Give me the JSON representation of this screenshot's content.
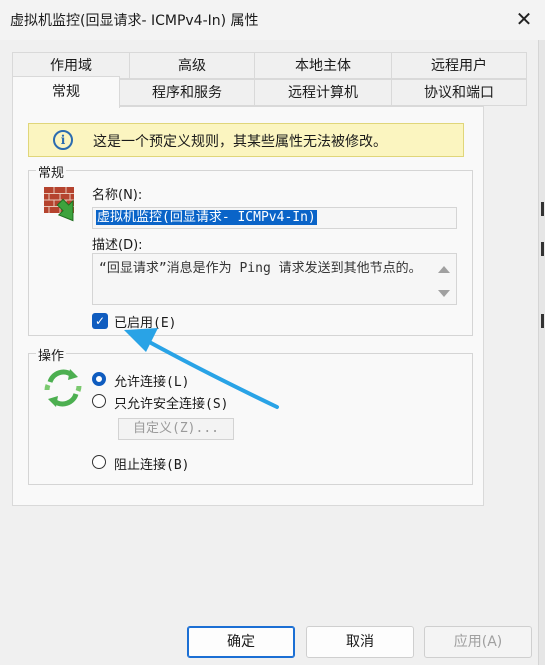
{
  "window": {
    "title": "虚拟机监控(回显请求- ICMPv4-In) 属性",
    "close_icon": "close-icon"
  },
  "tabs": {
    "back_row": [
      "作用域",
      "高级",
      "本地主体",
      "远程用户"
    ],
    "front_row": [
      "常规",
      "程序和服务",
      "远程计算机",
      "协议和端口"
    ],
    "active": "常规"
  },
  "info_banner": {
    "icon": "info-icon",
    "text": "这是一个预定义规则，其某些属性无法被修改。"
  },
  "general": {
    "group_label": "常规",
    "icon": "firewall-icon",
    "name_label": "名称(N):",
    "name_value": "虚拟机监控(回显请求- ICMPv4-In)",
    "desc_label": "描述(D):",
    "desc_value": "“回显请求”消息是作为 Ping 请求发送到其他节点的。",
    "enabled_label": "已启用(E)",
    "enabled_checked": true
  },
  "action": {
    "group_label": "操作",
    "icon": "allow-connection-icon",
    "options": [
      {
        "label": "允许连接(L)",
        "checked": true
      },
      {
        "label": "只允许安全连接(S)",
        "checked": false
      },
      {
        "label": "阻止连接(B)",
        "checked": false
      }
    ],
    "customize_label": "自定义(Z)..."
  },
  "footer": {
    "ok": "确定",
    "cancel": "取消",
    "apply": "应用(A)"
  },
  "colors": {
    "accent": "#0f5cbf",
    "banner": "#fbf5c0",
    "annotation_arrow": "#29a3e6"
  }
}
